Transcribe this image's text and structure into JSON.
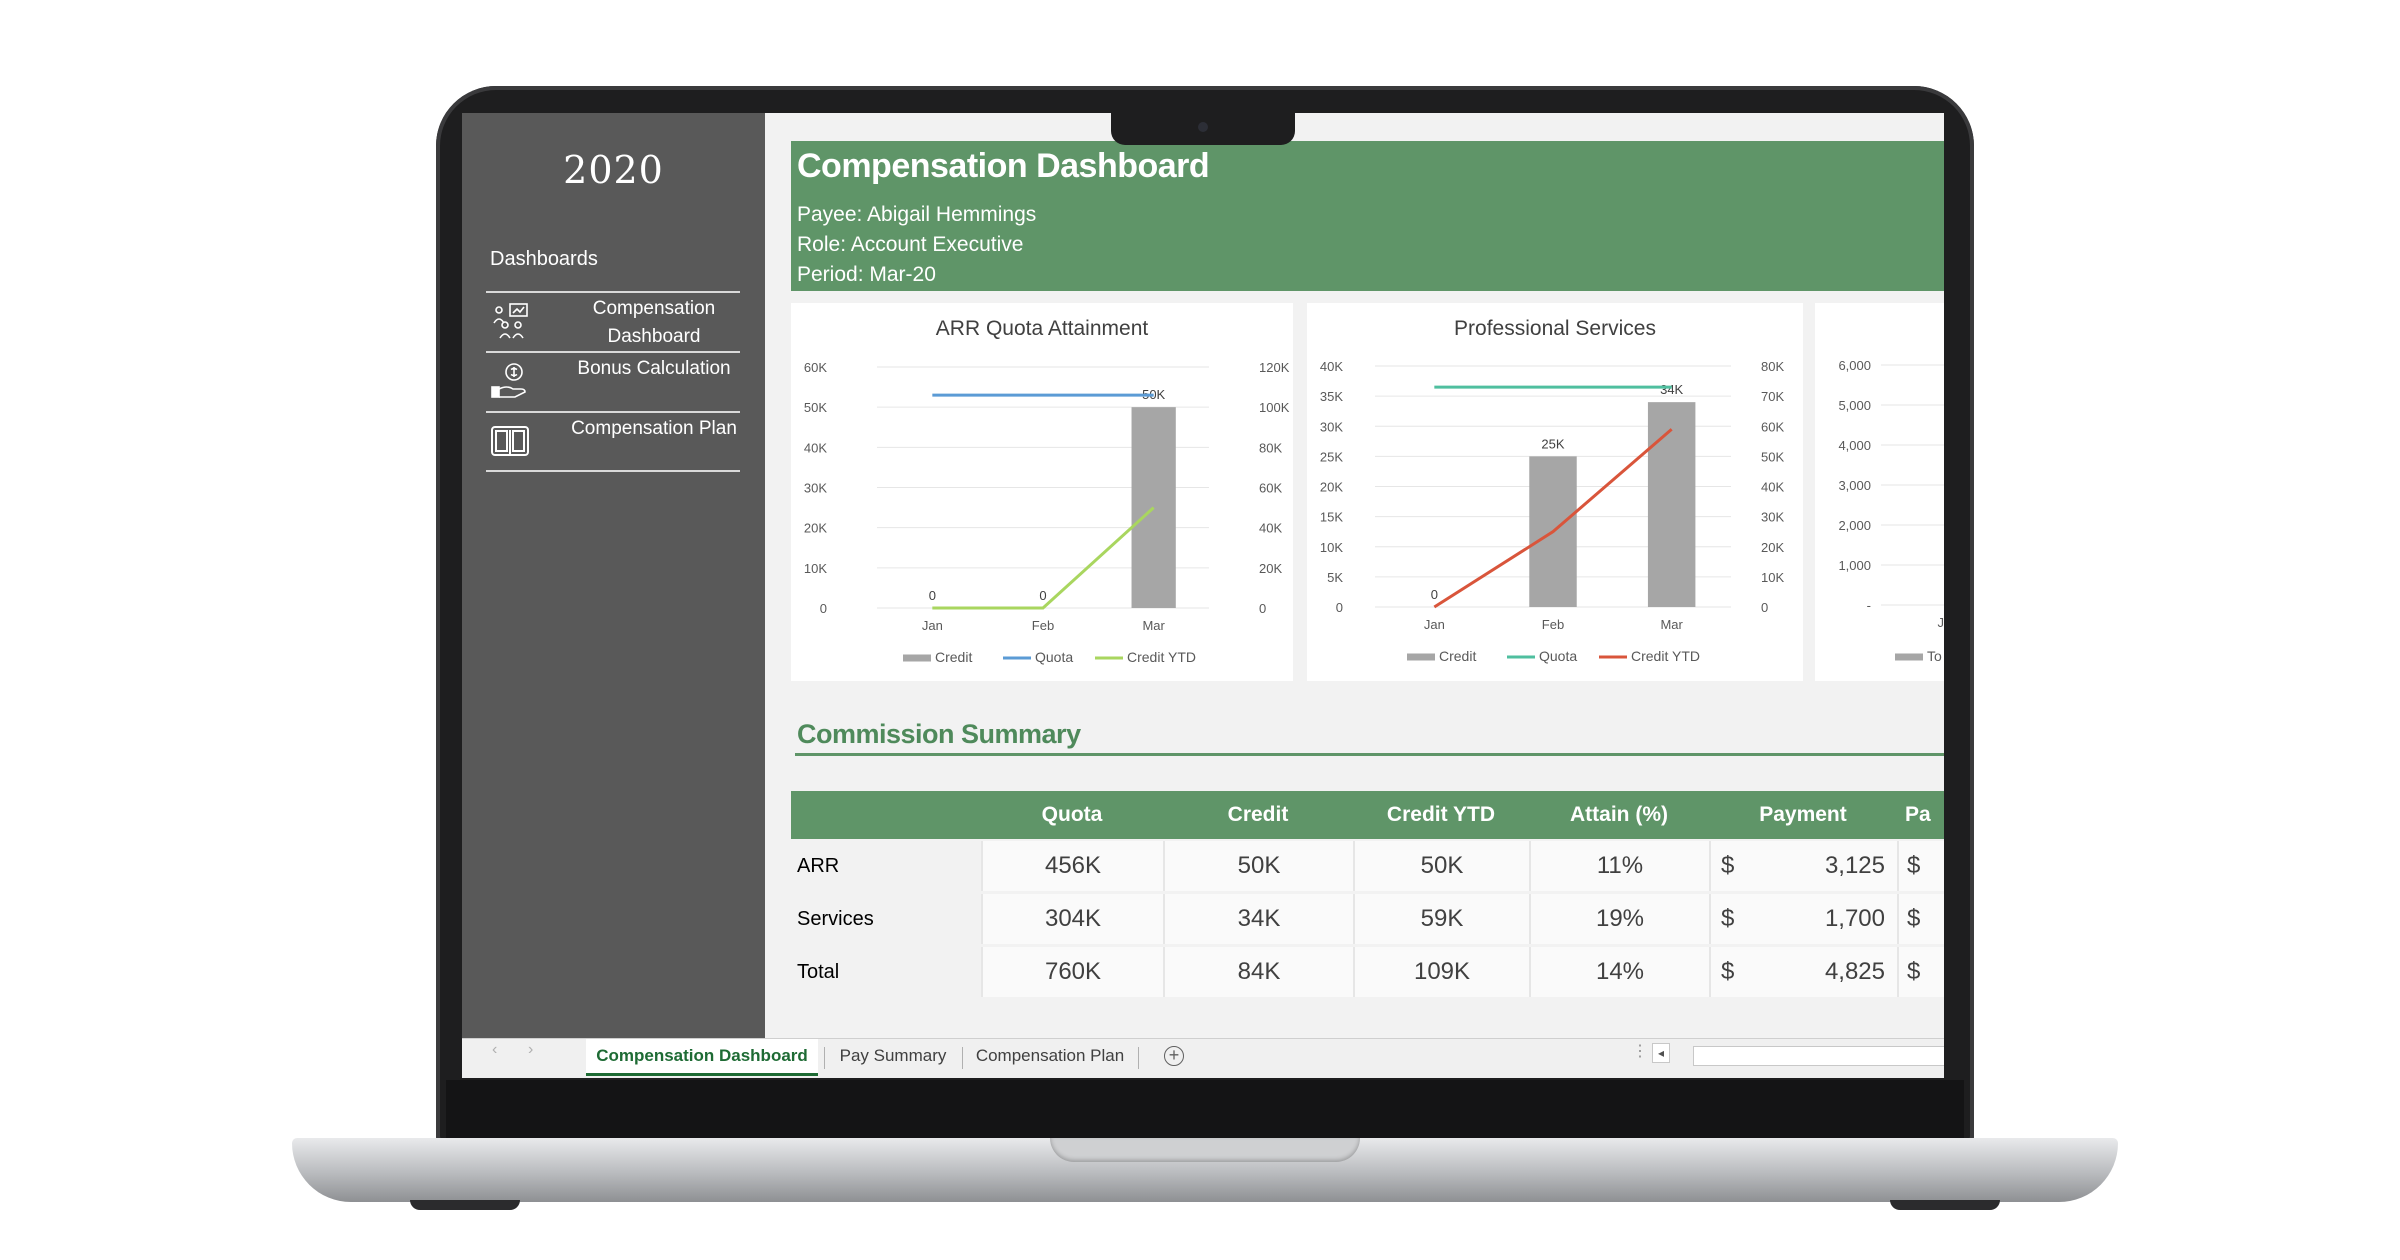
{
  "sidebar": {
    "year": "2020",
    "heading": "Dashboards",
    "items": [
      {
        "label": "Compensation Dashboard",
        "icon": "team-presentation-icon"
      },
      {
        "label": "Bonus Calculation",
        "icon": "money-hand-icon"
      },
      {
        "label": "Compensation Plan",
        "icon": "open-book-icon"
      }
    ]
  },
  "header": {
    "title": "Compensation Dashboard",
    "payee": "Payee: Abigail Hemmings",
    "role": "Role: Account Executive",
    "period": "Period: Mar-20"
  },
  "chart_data": [
    {
      "type": "bar",
      "title": "ARR Quota Attainment",
      "categories": [
        "Jan",
        "Feb",
        "Mar"
      ],
      "y_left_ticks": [
        "60K",
        "50K",
        "40K",
        "30K",
        "20K",
        "10K",
        "0"
      ],
      "y_right_ticks": [
        "120K",
        "100K",
        "80K",
        "60K",
        "40K",
        "20K",
        "0"
      ],
      "ylim_left": [
        0,
        60000
      ],
      "ylim_right": [
        0,
        120000
      ],
      "series": [
        {
          "name": "Credit",
          "kind": "bar",
          "axis": "left",
          "values": [
            0,
            0,
            50000
          ],
          "labels": [
            "0",
            "0",
            "50K"
          ],
          "color": "#a6a6a6"
        },
        {
          "name": "Quota",
          "kind": "line",
          "axis": "left",
          "values": [
            53000,
            53000,
            53000
          ],
          "color": "#5b9bd5"
        },
        {
          "name": "Credit YTD",
          "kind": "line",
          "axis": "right",
          "values": [
            0,
            0,
            50000
          ],
          "color": "#a9d65f"
        }
      ],
      "legend": "bottom"
    },
    {
      "type": "bar",
      "title": "Professional Services",
      "categories": [
        "Jan",
        "Feb",
        "Mar"
      ],
      "y_left_ticks": [
        "40K",
        "35K",
        "30K",
        "25K",
        "20K",
        "15K",
        "10K",
        "5K",
        "0"
      ],
      "y_right_ticks": [
        "80K",
        "70K",
        "60K",
        "50K",
        "40K",
        "30K",
        "20K",
        "10K",
        "0"
      ],
      "ylim_left": [
        0,
        40000
      ],
      "ylim_right": [
        0,
        80000
      ],
      "series": [
        {
          "name": "Credit",
          "kind": "bar",
          "axis": "left",
          "values": [
            0,
            25000,
            34000
          ],
          "labels": [
            "0",
            "25K",
            "34K"
          ],
          "color": "#a6a6a6"
        },
        {
          "name": "Quota",
          "kind": "line",
          "axis": "left",
          "values": [
            36500,
            36500,
            36500
          ],
          "color": "#4fbf9f"
        },
        {
          "name": "Credit YTD",
          "kind": "line",
          "axis": "right",
          "values": [
            0,
            25000,
            59000
          ],
          "color": "#d9553b"
        }
      ],
      "legend": "bottom"
    },
    {
      "type": "bar",
      "title": "",
      "categories": [
        "Jan"
      ],
      "y_left_ticks": [
        "6,000",
        "5,000",
        "4,000",
        "3,000",
        "2,000",
        "1,000",
        "-"
      ],
      "ylim_left": [
        0,
        6000
      ],
      "series": [
        {
          "name": "To",
          "kind": "bar",
          "axis": "left",
          "values": [
            0
          ],
          "color": "#a6a6a6"
        }
      ],
      "legend": "bottom"
    }
  ],
  "commission": {
    "title": "Commission Summary",
    "columns": [
      "Quota",
      "Credit",
      "Credit YTD",
      "Attain (%)",
      "Payment",
      "Pa"
    ],
    "rows": [
      {
        "label": "ARR",
        "quota": "456K",
        "credit": "50K",
        "credit_ytd": "50K",
        "attain": "11%",
        "payment_symbol": "$",
        "payment": "3,125",
        "next_symbol": "$"
      },
      {
        "label": "Services",
        "quota": "304K",
        "credit": "34K",
        "credit_ytd": "59K",
        "attain": "19%",
        "payment_symbol": "$",
        "payment": "1,700",
        "next_symbol": "$"
      },
      {
        "label": "Total",
        "quota": "760K",
        "credit": "84K",
        "credit_ytd": "109K",
        "attain": "14%",
        "payment_symbol": "$",
        "payment": "4,825",
        "next_symbol": "$"
      }
    ]
  },
  "tabs": {
    "items": [
      "Compensation Dashboard",
      "Pay Summary",
      "Compensation Plan"
    ],
    "active": "Compensation Dashboard",
    "add_symbol": "+",
    "prev_symbol": "‹",
    "next_symbol": "›",
    "scroll_left_symbol": "◂",
    "more_symbol": "⋮"
  },
  "colors": {
    "accent_green": "#5f9568",
    "sidebar_gray": "#595959"
  }
}
